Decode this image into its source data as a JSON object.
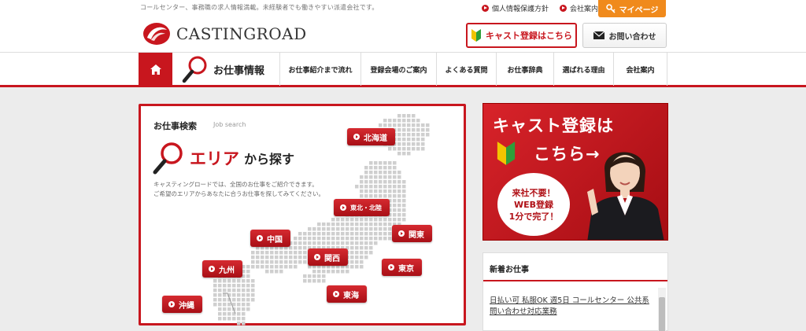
{
  "header": {
    "tagline": "コールセンター、事務職の求人情報満載。未経験者でも働きやすい派遣会社です。",
    "links": [
      "個人情報保護方針",
      "会社案内"
    ],
    "mypage": "マイページ",
    "logo": "CASTINGROAD",
    "cast_button": "キャスト登録はこちら",
    "contact_button": "お問い合わせ"
  },
  "nav": {
    "jobs": "お仕事情報",
    "items": [
      "お仕事紹介まで流れ",
      "登録会場のご案内",
      "よくある質問",
      "お仕事辞典",
      "選ばれる理由",
      "会社案内"
    ]
  },
  "search": {
    "title": "お仕事検索",
    "subtitle": "Job search",
    "area_big": "エリア",
    "area_small": "から探す",
    "desc_line1": "キャスティングロードでは、全国のお仕事をご紹介できます。",
    "desc_line2": "ご希望のエリアからあなたに合うお仕事を探してみてください。",
    "regions": [
      "北海道",
      "東北・北陸",
      "関東",
      "中国",
      "関西",
      "東京",
      "九州",
      "東海",
      "沖縄"
    ]
  },
  "banner": {
    "line1": "キャスト登録は",
    "line2": "こちら→",
    "circle1": "来社不要！",
    "circle2": "WEB登録",
    "circle3": "1分で完了！"
  },
  "newjobs": {
    "title": "新着お仕事",
    "link": "日払い可 私服OK 週5日 コールセンター 公共系問い合わせ対応業務"
  },
  "colors": {
    "brand_red": "#c8161e",
    "mypage_orange": "#f08a1c"
  }
}
